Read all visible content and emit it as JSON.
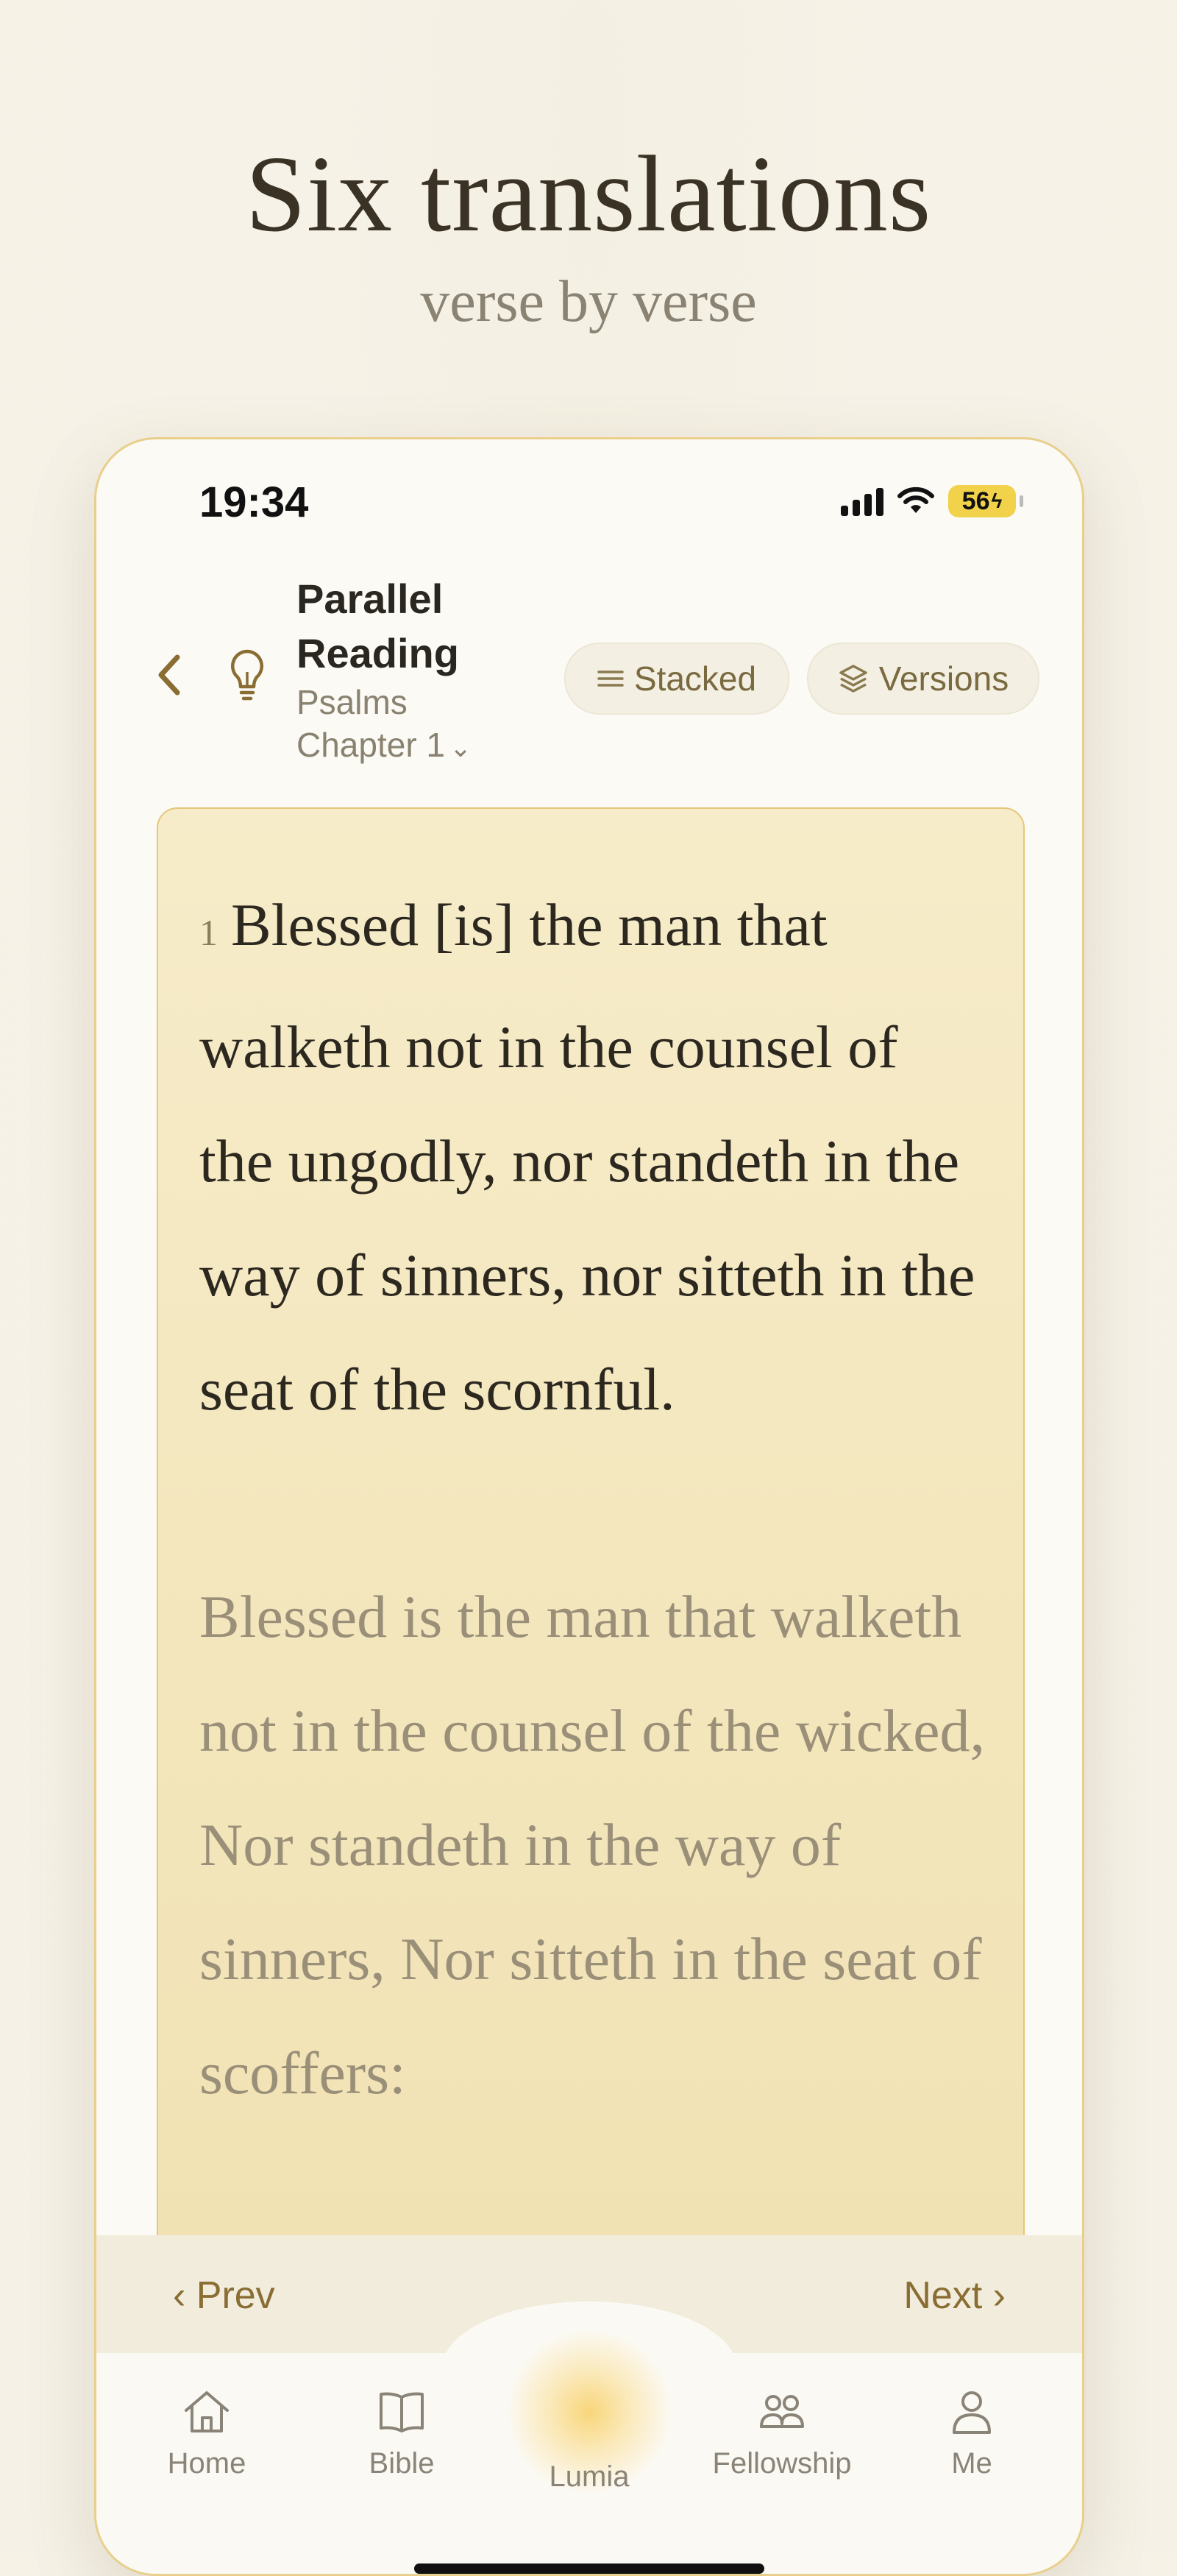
{
  "hero": {
    "title": "Six translations",
    "subtitle": "verse by verse"
  },
  "status_bar": {
    "time": "19:34",
    "battery": "56"
  },
  "header": {
    "title": "Parallel Reading",
    "book": "Psalms",
    "chapter": "Chapter 1",
    "stacked_label": "Stacked",
    "versions_label": "Versions"
  },
  "verse": {
    "number": "1",
    "primary_text": "Blessed [is] the man that walketh not in the counsel of the ungodly, nor standeth in the way of sinners, nor sitteth in the seat of the scornful.",
    "secondary_text": "Blessed is the man that walketh not in the counsel of the wicked, Nor standeth in the way of sinners, Nor sitteth in the seat of scoffers:"
  },
  "pager": {
    "prev_label": "‹ Prev",
    "next_label": "Next ›"
  },
  "tabbar": {
    "items": [
      {
        "label": "Home",
        "icon": "home-icon"
      },
      {
        "label": "Bible",
        "icon": "book-icon"
      },
      {
        "label": "Lumia",
        "icon": "glow-orb-icon"
      },
      {
        "label": "Fellowship",
        "icon": "people-icon"
      },
      {
        "label": "Me",
        "icon": "person-icon"
      }
    ]
  },
  "colors": {
    "accent": "#8a6d32",
    "card_bg": "#f3e6bd",
    "card_border": "#e4c779",
    "battery": "#f1d24a"
  }
}
